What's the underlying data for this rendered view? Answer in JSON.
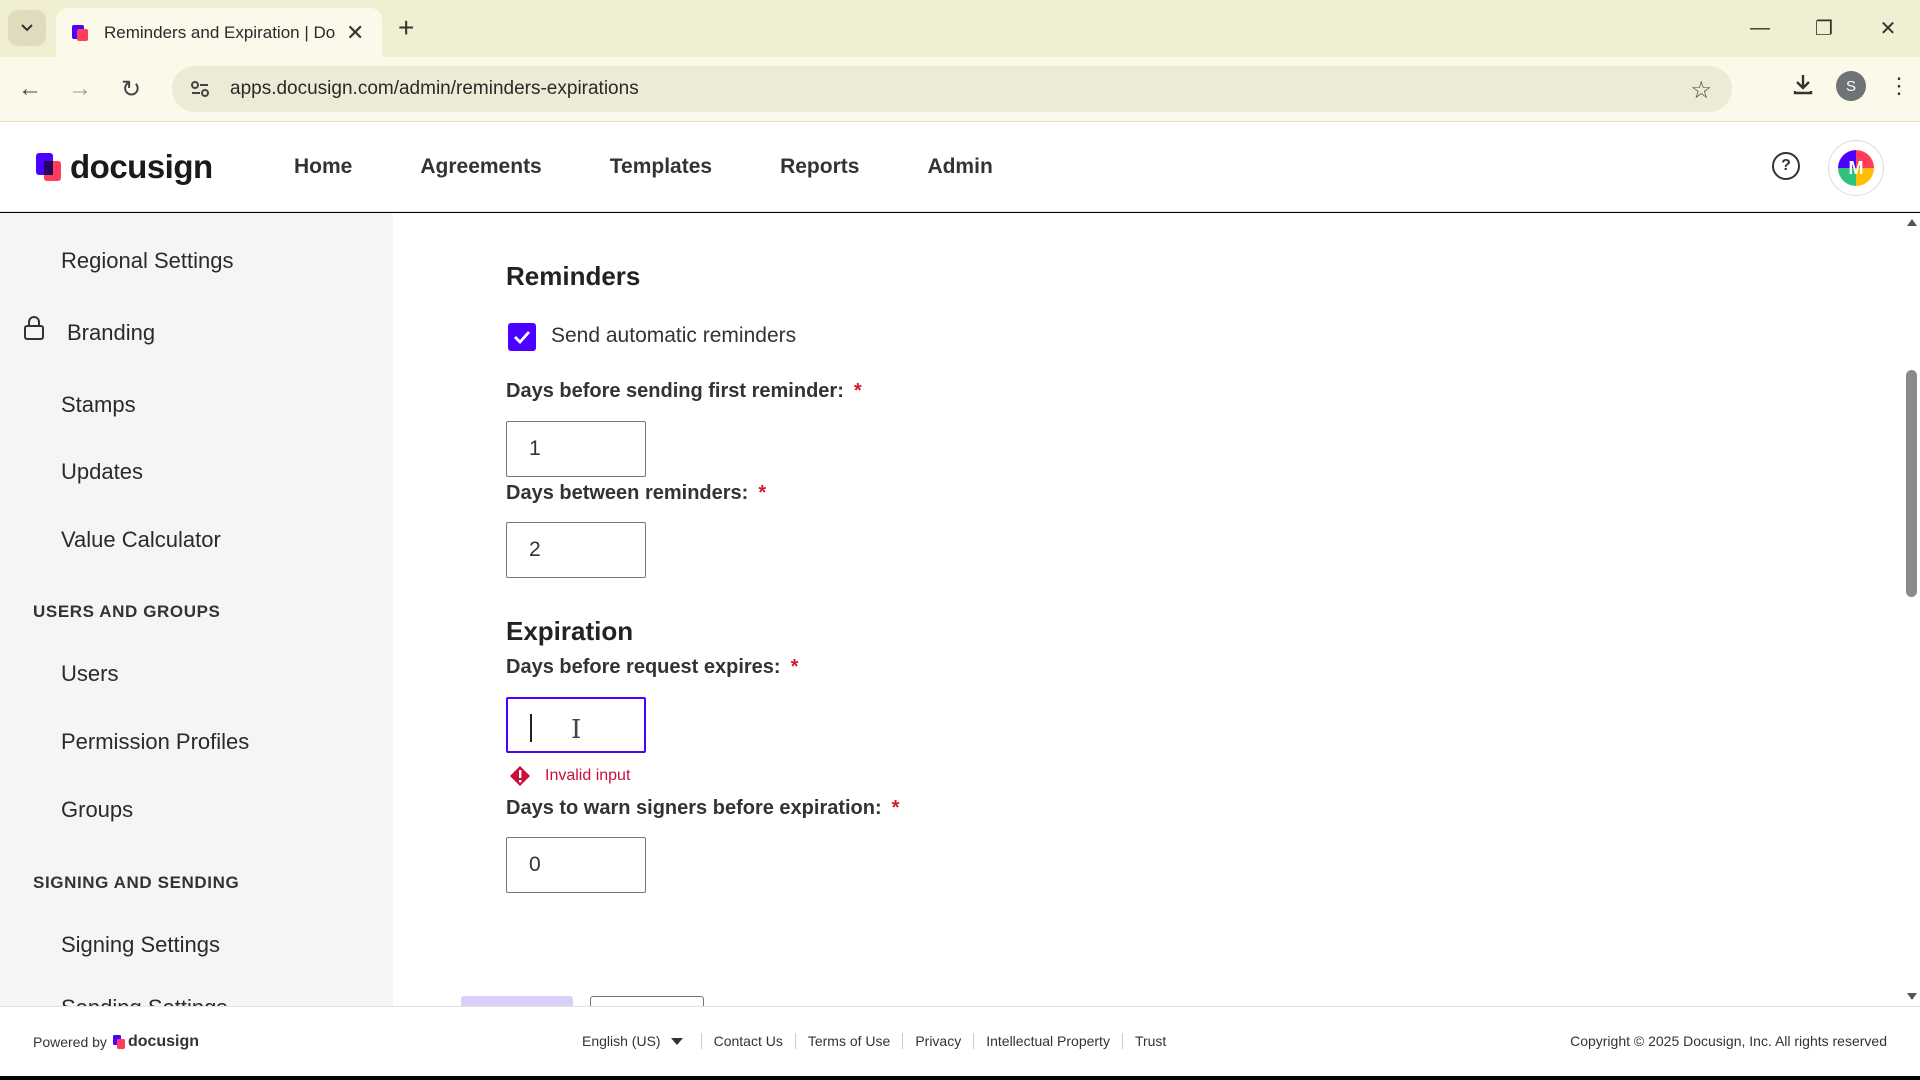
{
  "browser": {
    "tab_title": "Reminders and Expiration | Doc",
    "url": "apps.docusign.com/admin/reminders-expirations",
    "profile_initial": "S"
  },
  "header": {
    "logo_text": "docusign",
    "nav": [
      "Home",
      "Agreements",
      "Templates",
      "Reports",
      "Admin"
    ],
    "avatar_initial": "M"
  },
  "sidebar": {
    "items_top": [
      "Regional Settings",
      "Branding",
      "Stamps",
      "Updates",
      "Value Calculator"
    ],
    "users_groups_heading": "USERS AND GROUPS",
    "users_groups_items": [
      "Users",
      "Permission Profiles",
      "Groups"
    ],
    "signing_heading": "SIGNING AND SENDING",
    "signing_items": [
      "Signing Settings",
      "Sending Settings"
    ]
  },
  "reminders": {
    "title": "Reminders",
    "checkbox_label": "Send automatic reminders",
    "checkbox_checked": true,
    "first_reminder_label": "Days before sending first reminder:",
    "first_reminder_value": "1",
    "between_label": "Days between reminders:",
    "between_value": "2"
  },
  "expiration": {
    "title": "Expiration",
    "expires_label": "Days before request expires:",
    "expires_value": "",
    "error_text": "Invalid input",
    "warn_label": "Days to warn signers before expiration:",
    "warn_value": "0"
  },
  "required_mark": "*",
  "footer": {
    "powered_by": "Powered by",
    "powered_logo": "docusign",
    "language": "English (US)",
    "links": [
      "Contact Us",
      "Terms of Use",
      "Privacy",
      "Intellectual Property",
      "Trust"
    ],
    "copyright": "Copyright © 2025 Docusign, Inc. All rights reserved"
  },
  "colors": {
    "accent": "#4c00ff",
    "error": "#c8103a",
    "required": "#d11a2a"
  }
}
